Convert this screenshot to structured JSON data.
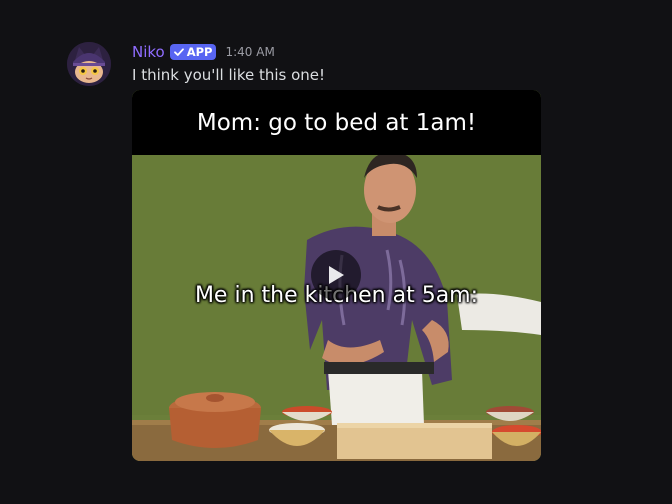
{
  "message": {
    "author": "Niko",
    "badge": "APP",
    "timestamp": "1:40 AM",
    "text": "I think you'll like this one!",
    "avatar_icon": "niko-cat-avatar-icon"
  },
  "video": {
    "caption_top": "Mom: go to bed at 1am!",
    "caption_middle": "Me in the kitchen at 5am:",
    "play_icon": "play-icon"
  },
  "colors": {
    "background": "#111114",
    "username": "#8f6cff",
    "badge": "#5865f2",
    "timestamp": "#9a9ba3",
    "message_text": "#dbdee1",
    "video_wall": "#667a37"
  }
}
